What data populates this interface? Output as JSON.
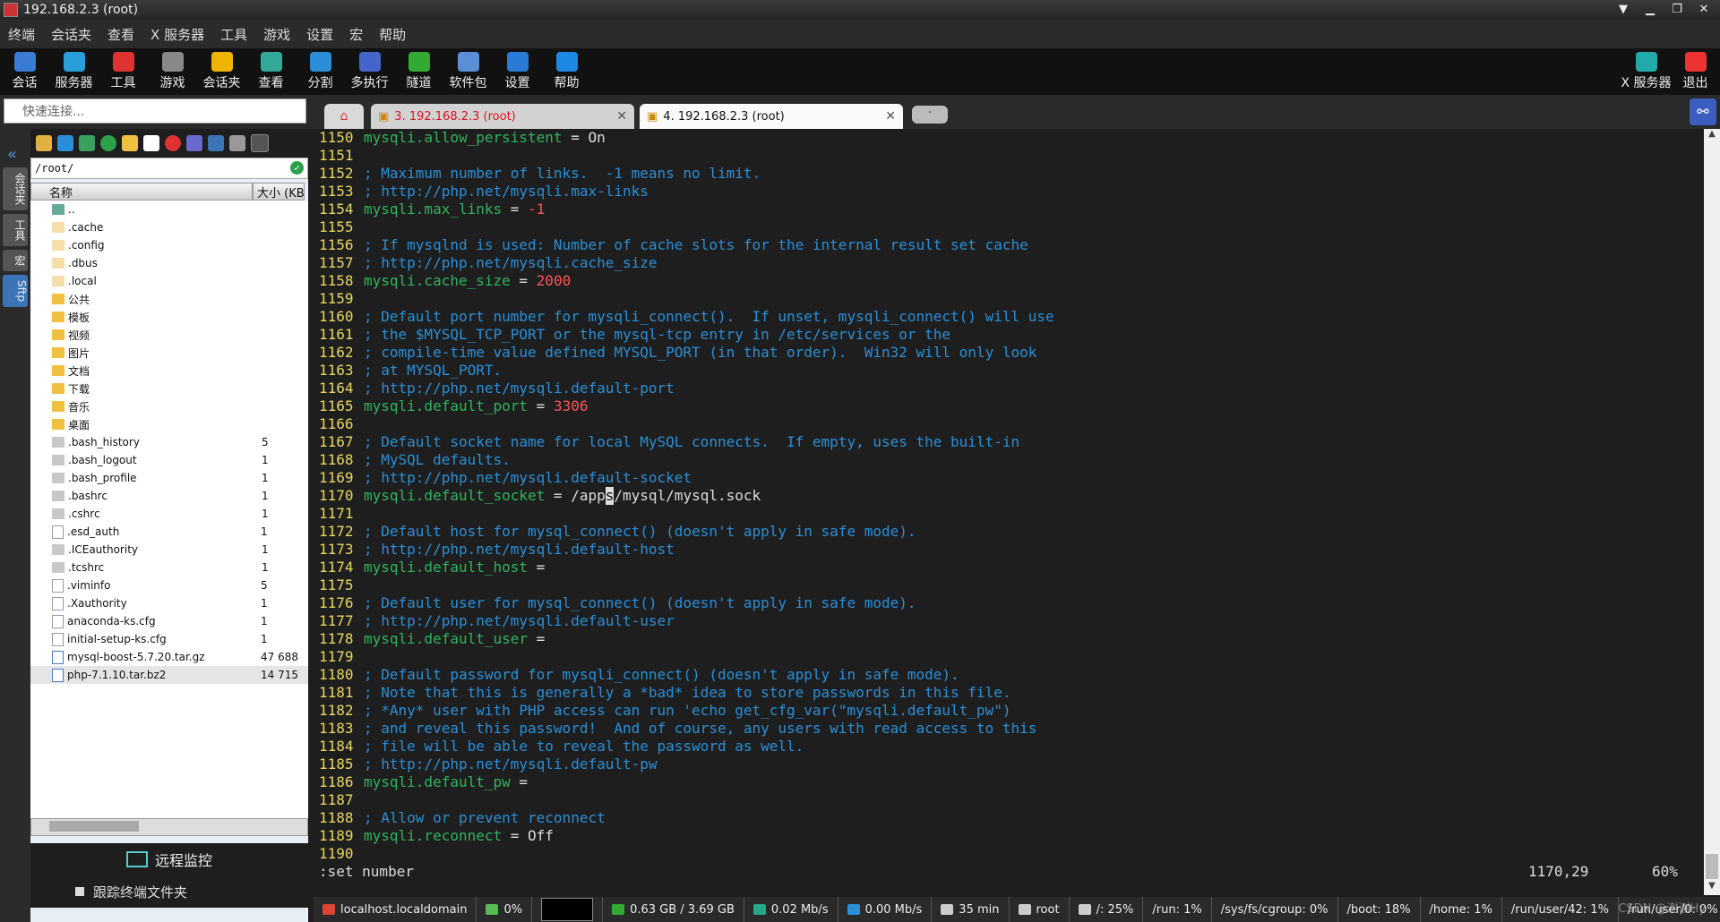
{
  "window": {
    "title": "192.168.2.3 (root)"
  },
  "menu": [
    "终端",
    "会话夹",
    "查看",
    "X 服务器",
    "工具",
    "游戏",
    "设置",
    "宏",
    "帮助"
  ],
  "toolbar": {
    "left": [
      {
        "label": "会话",
        "icon": "session-icon",
        "color": "#3a7bd5"
      },
      {
        "label": "服务器",
        "icon": "servers-icon",
        "color": "#2a9ed8"
      },
      {
        "label": "工具",
        "icon": "tools-icon",
        "color": "#d33"
      },
      {
        "label": "游戏",
        "icon": "games-icon",
        "color": "#888"
      },
      {
        "label": "会话夹",
        "icon": "star-icon",
        "color": "#f0b400"
      },
      {
        "label": "查看",
        "icon": "view-icon",
        "color": "#3a9"
      },
      {
        "label": "分割",
        "icon": "split-icon",
        "color": "#2a8fd8"
      },
      {
        "label": "多执行",
        "icon": "multiexec-icon",
        "color": "#4466cc"
      },
      {
        "label": "隧道",
        "icon": "tunnel-icon",
        "color": "#3a3"
      },
      {
        "label": "软件包",
        "icon": "packages-icon",
        "color": "#5a8fd8"
      },
      {
        "label": "设置",
        "icon": "gear-icon",
        "color": "#2a7bd5"
      },
      {
        "label": "帮助",
        "icon": "help-icon",
        "color": "#1e88e5"
      }
    ],
    "right": [
      {
        "label": "X 服务器",
        "icon": "x-server-icon",
        "color": "#2aa"
      },
      {
        "label": "退出",
        "icon": "power-icon",
        "color": "#e33"
      }
    ]
  },
  "quick_connect": {
    "placeholder": "快速连接..."
  },
  "tabs": [
    {
      "label": "3. 192.168.2.3 (root)"
    },
    {
      "label": "4. 192.168.2.3 (root)"
    }
  ],
  "side_tabs": [
    "会话夹",
    "工具",
    "宏",
    "Sftp"
  ],
  "sftp": {
    "path": "/root/",
    "columns": {
      "name": "名称",
      "size": "大小 (KB)"
    },
    "files": [
      {
        "name": "..",
        "size": "",
        "type": "up"
      },
      {
        "name": ".cache",
        "size": "",
        "type": "folder-light"
      },
      {
        "name": ".config",
        "size": "",
        "type": "folder-light"
      },
      {
        "name": ".dbus",
        "size": "",
        "type": "folder-light"
      },
      {
        "name": ".local",
        "size": "",
        "type": "folder-light"
      },
      {
        "name": "公共",
        "size": "",
        "type": "folder"
      },
      {
        "name": "模板",
        "size": "",
        "type": "folder"
      },
      {
        "name": "视频",
        "size": "",
        "type": "folder"
      },
      {
        "name": "图片",
        "size": "",
        "type": "folder"
      },
      {
        "name": "文档",
        "size": "",
        "type": "folder"
      },
      {
        "name": "下载",
        "size": "",
        "type": "folder"
      },
      {
        "name": "音乐",
        "size": "",
        "type": "folder"
      },
      {
        "name": "桌面",
        "size": "",
        "type": "folder"
      },
      {
        "name": ".bash_history",
        "size": "5",
        "type": "hidden"
      },
      {
        "name": ".bash_logout",
        "size": "1",
        "type": "hidden"
      },
      {
        "name": ".bash_profile",
        "size": "1",
        "type": "hidden"
      },
      {
        "name": ".bashrc",
        "size": "1",
        "type": "hidden"
      },
      {
        "name": ".cshrc",
        "size": "1",
        "type": "hidden"
      },
      {
        "name": ".esd_auth",
        "size": "1",
        "type": "doc"
      },
      {
        "name": ".ICEauthority",
        "size": "1",
        "type": "hidden"
      },
      {
        "name": ".tcshrc",
        "size": "1",
        "type": "hidden"
      },
      {
        "name": ".viminfo",
        "size": "5",
        "type": "doc"
      },
      {
        "name": ".Xauthority",
        "size": "1",
        "type": "doc"
      },
      {
        "name": "anaconda-ks.cfg",
        "size": "1",
        "type": "doc"
      },
      {
        "name": "initial-setup-ks.cfg",
        "size": "1",
        "type": "doc"
      },
      {
        "name": "mysql-boost-5.7.20.tar.gz",
        "size": "47 688",
        "type": "archive"
      },
      {
        "name": "php-7.1.10.tar.bz2",
        "size": "14 715",
        "type": "archive",
        "selected": true
      }
    ],
    "remote_monitor": "远程监控",
    "follow_folder": "跟踪终端文件夹"
  },
  "terminal": {
    "lines": [
      {
        "n": "1150",
        "parts": [
          [
            "key",
            "mysqli.allow_persistent"
          ],
          [
            "eq",
            " = "
          ],
          [
            "code",
            "On"
          ]
        ]
      },
      {
        "n": "1151",
        "parts": []
      },
      {
        "n": "1152",
        "parts": [
          [
            "comment",
            "; Maximum number of links.  -1 means no limit."
          ]
        ]
      },
      {
        "n": "1153",
        "parts": [
          [
            "comment",
            "; http://php.net/mysqli.max-links"
          ]
        ]
      },
      {
        "n": "1154",
        "parts": [
          [
            "key",
            "mysqli.max_links"
          ],
          [
            "eq",
            " = "
          ],
          [
            "num",
            "-1"
          ]
        ]
      },
      {
        "n": "1155",
        "parts": []
      },
      {
        "n": "1156",
        "parts": [
          [
            "comment",
            "; If mysqlnd is used: Number of cache slots for the internal result set cache"
          ]
        ]
      },
      {
        "n": "1157",
        "parts": [
          [
            "comment",
            "; http://php.net/mysqli.cache_size"
          ]
        ]
      },
      {
        "n": "1158",
        "parts": [
          [
            "key",
            "mysqli.cache_size"
          ],
          [
            "eq",
            " = "
          ],
          [
            "num",
            "2000"
          ]
        ]
      },
      {
        "n": "1159",
        "parts": []
      },
      {
        "n": "1160",
        "parts": [
          [
            "comment",
            "; Default port number for mysqli_connect().  If unset, mysqli_connect() will use"
          ]
        ]
      },
      {
        "n": "1161",
        "parts": [
          [
            "comment",
            "; the $MYSQL_TCP_PORT or the mysql-tcp entry in /etc/services or the"
          ]
        ]
      },
      {
        "n": "1162",
        "parts": [
          [
            "comment",
            "; compile-time value defined MYSQL_PORT (in that order).  Win32 will only look"
          ]
        ]
      },
      {
        "n": "1163",
        "parts": [
          [
            "comment",
            "; at MYSQL_PORT."
          ]
        ]
      },
      {
        "n": "1164",
        "parts": [
          [
            "comment",
            "; http://php.net/mysqli.default-port"
          ]
        ]
      },
      {
        "n": "1165",
        "parts": [
          [
            "key",
            "mysqli.default_port"
          ],
          [
            "eq",
            " = "
          ],
          [
            "num",
            "3306"
          ]
        ]
      },
      {
        "n": "1166",
        "parts": []
      },
      {
        "n": "1167",
        "parts": [
          [
            "comment",
            "; Default socket name for local MySQL connects.  If empty, uses the built-in"
          ]
        ]
      },
      {
        "n": "1168",
        "parts": [
          [
            "comment",
            "; MySQL defaults."
          ]
        ]
      },
      {
        "n": "1169",
        "parts": [
          [
            "comment",
            "; http://php.net/mysqli.default-socket"
          ]
        ]
      },
      {
        "n": "1170",
        "parts": [
          [
            "key",
            "mysqli.default_socket"
          ],
          [
            "eq",
            " = "
          ],
          [
            "code",
            "/app"
          ],
          [
            "cursor",
            "s"
          ],
          [
            "code",
            "/mysql/mysql.sock"
          ]
        ]
      },
      {
        "n": "1171",
        "parts": []
      },
      {
        "n": "1172",
        "parts": [
          [
            "comment",
            "; Default host for mysql_connect() (doesn't apply in safe mode)."
          ]
        ]
      },
      {
        "n": "1173",
        "parts": [
          [
            "comment",
            "; http://php.net/mysqli.default-host"
          ]
        ]
      },
      {
        "n": "1174",
        "parts": [
          [
            "key",
            "mysqli.default_host"
          ],
          [
            "eq",
            " ="
          ]
        ]
      },
      {
        "n": "1175",
        "parts": []
      },
      {
        "n": "1176",
        "parts": [
          [
            "comment",
            "; Default user for mysql_connect() (doesn't apply in safe mode)."
          ]
        ]
      },
      {
        "n": "1177",
        "parts": [
          [
            "comment",
            "; http://php.net/mysqli.default-user"
          ]
        ]
      },
      {
        "n": "1178",
        "parts": [
          [
            "key",
            "mysqli.default_user"
          ],
          [
            "eq",
            " ="
          ]
        ]
      },
      {
        "n": "1179",
        "parts": []
      },
      {
        "n": "1180",
        "parts": [
          [
            "comment",
            "; Default password for mysqli_connect() (doesn't apply in safe mode)."
          ]
        ]
      },
      {
        "n": "1181",
        "parts": [
          [
            "comment",
            "; Note that this is generally a *bad* idea to store passwords in this file."
          ]
        ]
      },
      {
        "n": "1182",
        "parts": [
          [
            "comment",
            "; *Any* user with PHP access can run 'echo get_cfg_var(\"mysqli.default_pw\")"
          ]
        ]
      },
      {
        "n": "1183",
        "parts": [
          [
            "comment",
            "; and reveal this password!  And of course, any users with read access to this"
          ]
        ]
      },
      {
        "n": "1184",
        "parts": [
          [
            "comment",
            "; file will be able to reveal the password as well."
          ]
        ]
      },
      {
        "n": "1185",
        "parts": [
          [
            "comment",
            "; http://php.net/mysqli.default-pw"
          ]
        ]
      },
      {
        "n": "1186",
        "parts": [
          [
            "key",
            "mysqli.default_pw"
          ],
          [
            "eq",
            " ="
          ]
        ]
      },
      {
        "n": "1187",
        "parts": []
      },
      {
        "n": "1188",
        "parts": [
          [
            "comment",
            "; Allow or prevent reconnect"
          ]
        ]
      },
      {
        "n": "1189",
        "parts": [
          [
            "key",
            "mysqli.reconnect"
          ],
          [
            "eq",
            " = "
          ],
          [
            "code",
            "Off"
          ]
        ]
      },
      {
        "n": "1190",
        "parts": []
      }
    ],
    "command": ":set number",
    "position": "1170,29",
    "percent": "60%"
  },
  "statusbar": [
    {
      "text": "localhost.localdomain",
      "icon": "server-status-icon",
      "color": "#d43"
    },
    {
      "text": "0%",
      "icon": "cpu-icon",
      "color": "#5b5"
    },
    {
      "text": "",
      "icon": "graph-icon",
      "color": "#000"
    },
    {
      "text": "0.63 GB / 3.69 GB",
      "icon": "memory-icon",
      "color": "#3a3"
    },
    {
      "text": "0.02 Mb/s",
      "icon": "upload-icon",
      "color": "#2a8"
    },
    {
      "text": "0.00 Mb/s",
      "icon": "download-icon",
      "color": "#2a8fd8"
    },
    {
      "text": "35 min",
      "icon": "uptime-icon",
      "color": "#ccc"
    },
    {
      "text": "root",
      "icon": "user-icon",
      "color": "#ccc"
    },
    {
      "text": "/: 25%",
      "icon": "disk-icon",
      "color": "#ccc"
    },
    {
      "text": "/run: 1%",
      "icon": "",
      "color": ""
    },
    {
      "text": "/sys/fs/cgroup: 0%",
      "icon": "",
      "color": ""
    },
    {
      "text": "/boot: 18%",
      "icon": "",
      "color": ""
    },
    {
      "text": "/home: 1%",
      "icon": "",
      "color": ""
    },
    {
      "text": "/run/user/42: 1%",
      "icon": "",
      "color": ""
    },
    {
      "text": "/run/user/0: 0%",
      "icon": "",
      "color": ""
    }
  ],
  "watermark": "CSDN @谢谢Hy"
}
